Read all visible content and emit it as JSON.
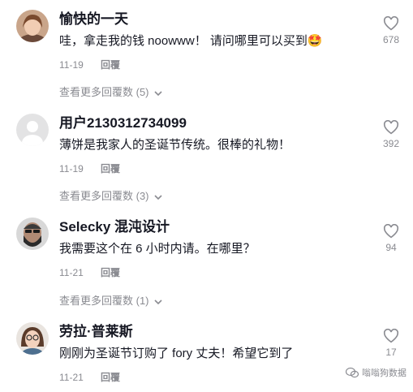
{
  "comments": [
    {
      "username": "愉快的一天",
      "text": "哇，拿走我的钱 noowww！ 请问哪里可以买到🤩",
      "date": "11-19",
      "reply_label": "回覆",
      "likes": "678",
      "more_replies": "查看更多回覆数 (5)",
      "avatar": "woman-photo"
    },
    {
      "username": "用户2130312734099",
      "text": "薄饼是我家人的圣诞节传统。很棒的礼物！",
      "date": "11-19",
      "reply_label": "回覆",
      "likes": "392",
      "more_replies": "查看更多回覆数 (3)",
      "avatar": "default-user"
    },
    {
      "username": "Selecky 混沌设计",
      "text": "我需要这个在 6 小时内请。在哪里？",
      "date": "11-21",
      "reply_label": "回覆",
      "likes": "94",
      "more_replies": "查看更多回覆数 (1)",
      "avatar": "bearded-man-photo"
    },
    {
      "username": "劳拉·普莱斯",
      "text": "刚刚为圣诞节订购了 fory 丈夫！希望它到了",
      "date": "11-21",
      "reply_label": "回覆",
      "likes": "17",
      "more_replies": "",
      "avatar": "woman-glasses-photo"
    }
  ],
  "watermark": "嗡嗡狗数据",
  "colors": {
    "text": "#161823",
    "muted": "#8a8b91"
  }
}
